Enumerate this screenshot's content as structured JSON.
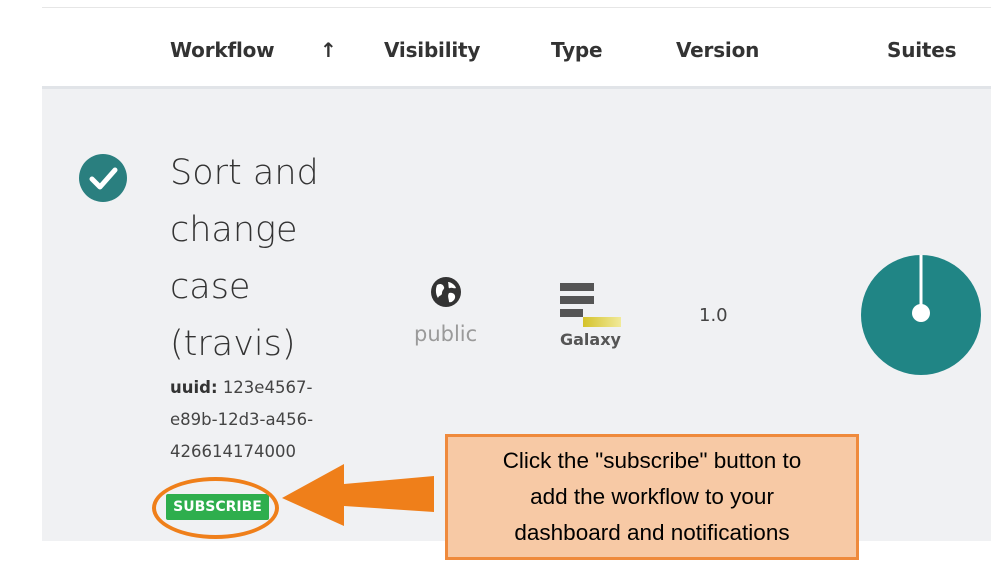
{
  "table": {
    "headers": {
      "workflow": "Workflow",
      "sort_indicator": "↑",
      "visibility": "Visibility",
      "type": "Type",
      "version": "Version",
      "suites": "Suites"
    },
    "rows": [
      {
        "title_lines": [
          "Sort and",
          "change",
          "case",
          "(travis)"
        ],
        "uuid_label": "uuid:",
        "uuid_lines": [
          "123e4567-",
          "e89b-12d3-a456-",
          "426614174000"
        ],
        "subscribe_label": "SUBSCRIBE",
        "visibility": "public",
        "visibility_icon": "globe-icon",
        "type_label": "Galaxy",
        "type_icon": "galaxy-logo",
        "version": "1.0",
        "suites_chart_icon": "pie-chart-icon"
      }
    ]
  },
  "annotation": {
    "lines": [
      "Click the \"subscribe\" button to",
      "add the workflow to your",
      "dashboard and notifications"
    ]
  },
  "colors": {
    "accent": "#2a7f7f",
    "subscribe_green": "#2eae4d",
    "annotation_orange": "#ef7f1a",
    "annotation_fill": "#f7c9a5"
  }
}
